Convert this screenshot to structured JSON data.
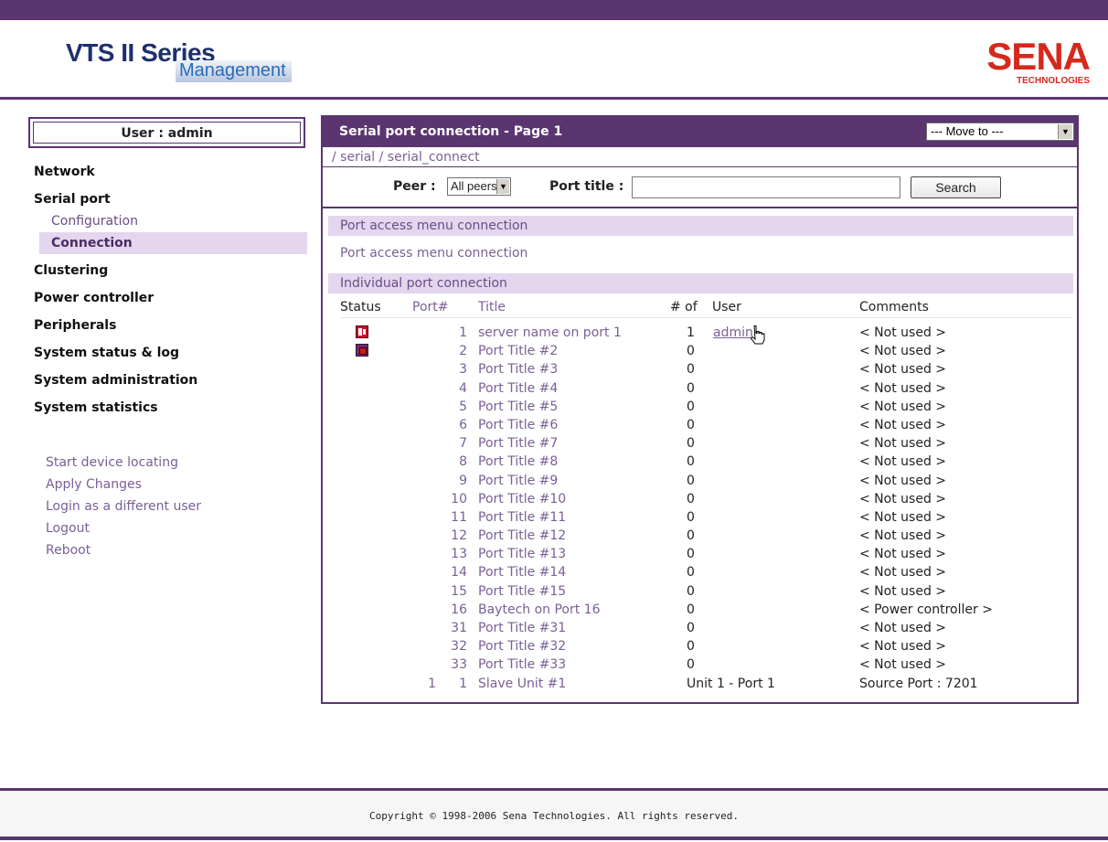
{
  "header": {
    "logo_line1": "VTS II Series",
    "logo_line2": "Management",
    "brand": "SENA",
    "brand_sub": "TECHNOLOGIES"
  },
  "sidebar": {
    "user_label": "User : admin",
    "nav": [
      {
        "label": "Network"
      },
      {
        "label": "Serial port",
        "children": [
          {
            "label": "Configuration",
            "active": false
          },
          {
            "label": "Connection",
            "active": true
          }
        ]
      },
      {
        "label": "Clustering"
      },
      {
        "label": "Power controller"
      },
      {
        "label": "Peripherals"
      },
      {
        "label": "System status & log"
      },
      {
        "label": "System administration"
      },
      {
        "label": "System statistics"
      }
    ],
    "links": [
      "Start device locating",
      "Apply Changes",
      "Login as a different user",
      "Logout",
      "Reboot"
    ]
  },
  "panel": {
    "title": "Serial port connection - Page 1",
    "move_to": "--- Move to ---",
    "breadcrumb": "/ serial / serial_connect",
    "search": {
      "peer_label": "Peer :",
      "peer_value": "All peers",
      "port_title_label": "Port title :",
      "port_title_value": "",
      "button": "Search"
    },
    "section1_header": "Port access menu connection",
    "section1_link": "Port access menu connection",
    "section2_header": "Individual port connection",
    "columns": {
      "status": "Status",
      "port": "Port#",
      "title": "Title",
      "num_of": "# of",
      "user": "User",
      "comments": "Comments"
    },
    "rows": [
      {
        "status": "active",
        "unit": "",
        "port": "1",
        "title": "server name on port 1",
        "num": "1",
        "user": "admin",
        "comment": "< Not used >"
      },
      {
        "status": "idle",
        "unit": "",
        "port": "2",
        "title": "Port Title #2",
        "num": "0",
        "user": "",
        "comment": "< Not used >"
      },
      {
        "status": "",
        "unit": "",
        "port": "3",
        "title": "Port Title #3",
        "num": "0",
        "user": "",
        "comment": "< Not used >"
      },
      {
        "status": "",
        "unit": "",
        "port": "4",
        "title": "Port Title #4",
        "num": "0",
        "user": "",
        "comment": "< Not used >"
      },
      {
        "status": "",
        "unit": "",
        "port": "5",
        "title": "Port Title #5",
        "num": "0",
        "user": "",
        "comment": "< Not used >"
      },
      {
        "status": "",
        "unit": "",
        "port": "6",
        "title": "Port Title #6",
        "num": "0",
        "user": "",
        "comment": "< Not used >"
      },
      {
        "status": "",
        "unit": "",
        "port": "7",
        "title": "Port Title #7",
        "num": "0",
        "user": "",
        "comment": "< Not used >"
      },
      {
        "status": "",
        "unit": "",
        "port": "8",
        "title": "Port Title #8",
        "num": "0",
        "user": "",
        "comment": "< Not used >"
      },
      {
        "status": "",
        "unit": "",
        "port": "9",
        "title": "Port Title #9",
        "num": "0",
        "user": "",
        "comment": "< Not used >"
      },
      {
        "status": "",
        "unit": "",
        "port": "10",
        "title": "Port Title #10",
        "num": "0",
        "user": "",
        "comment": "< Not used >"
      },
      {
        "status": "",
        "unit": "",
        "port": "11",
        "title": "Port Title #11",
        "num": "0",
        "user": "",
        "comment": "< Not used >"
      },
      {
        "status": "",
        "unit": "",
        "port": "12",
        "title": "Port Title #12",
        "num": "0",
        "user": "",
        "comment": "< Not used >"
      },
      {
        "status": "",
        "unit": "",
        "port": "13",
        "title": "Port Title #13",
        "num": "0",
        "user": "",
        "comment": "< Not used >"
      },
      {
        "status": "",
        "unit": "",
        "port": "14",
        "title": "Port Title #14",
        "num": "0",
        "user": "",
        "comment": "< Not used >"
      },
      {
        "status": "",
        "unit": "",
        "port": "15",
        "title": "Port Title #15",
        "num": "0",
        "user": "",
        "comment": "< Not used >"
      },
      {
        "status": "",
        "unit": "",
        "port": "16",
        "title": "Baytech on Port 16",
        "num": "0",
        "user": "",
        "comment": "< Power controller >"
      },
      {
        "status": "",
        "unit": "",
        "port": "31",
        "title": "Port Title #31",
        "num": "0",
        "user": "",
        "comment": "< Not used >"
      },
      {
        "status": "",
        "unit": "",
        "port": "32",
        "title": "Port Title #32",
        "num": "0",
        "user": "",
        "comment": "< Not used >"
      },
      {
        "status": "",
        "unit": "",
        "port": "33",
        "title": "Port Title #33",
        "num": "0",
        "user": "",
        "comment": "< Not used >"
      },
      {
        "status": "",
        "unit": "1",
        "port": "1",
        "title": "Slave Unit #1",
        "num": "Unit 1 - Port 1",
        "user": "",
        "comment": "Source Port : 7201"
      }
    ]
  },
  "footer": {
    "copyright": "Copyright © 1998-2006 Sena Technologies. All rights reserved."
  },
  "colors": {
    "brand_purple": "#5a3570",
    "section_bg": "#e3d6ee",
    "link_purple": "#7a5f96",
    "sena_red": "#d6291e"
  }
}
